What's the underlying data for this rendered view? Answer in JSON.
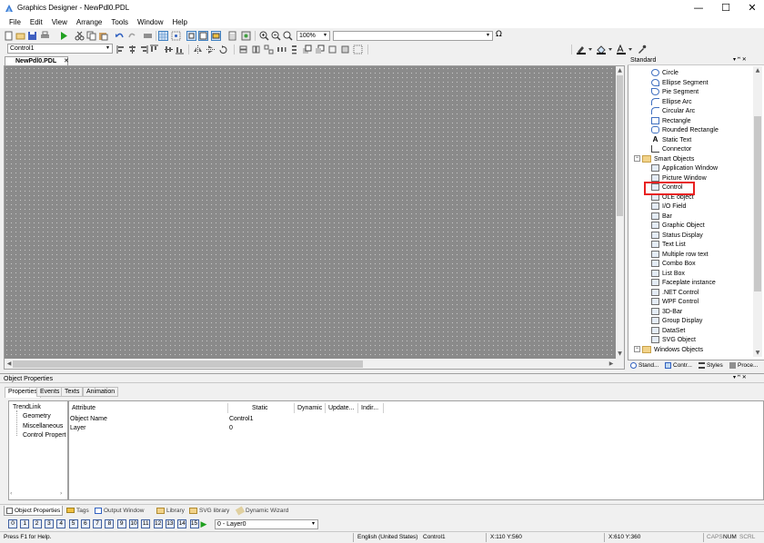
{
  "window": {
    "title": "Graphics Designer - NewPdl0.PDL",
    "minimize": "—",
    "maximize": "☐",
    "close": "✕"
  },
  "menu": [
    "File",
    "Edit",
    "View",
    "Arrange",
    "Tools",
    "Window",
    "Help"
  ],
  "toolbar": {
    "zoom_value": "100%",
    "font_field": "",
    "object_select": "Control1"
  },
  "palette": [
    "#c00000",
    "#ff0000",
    "#ff8000",
    "#ffff00",
    "#c0c000",
    "#00a000",
    "#00ff00",
    "#008080",
    "#00ffff",
    "#0000c0",
    "#0000ff",
    "#800080",
    "#ff00ff",
    "#808080",
    "#c0c0c0",
    "#ffffff",
    "#000000"
  ],
  "document_tab": {
    "label": "NewPdl0.PDL",
    "close": "✕"
  },
  "right_panel": {
    "title": "Standard",
    "header_btns": "▾ ꟸ ✕",
    "items": [
      {
        "label": "Circle",
        "icon": "circle-icon",
        "kind": "item"
      },
      {
        "label": "Ellipse Segment",
        "icon": "ellipse-segment-icon",
        "kind": "item"
      },
      {
        "label": "Pie Segment",
        "icon": "pie-segment-icon",
        "kind": "item"
      },
      {
        "label": "Ellipse Arc",
        "icon": "ellipse-arc-icon",
        "kind": "item"
      },
      {
        "label": "Circular Arc",
        "icon": "circular-arc-icon",
        "kind": "item"
      },
      {
        "label": "Rectangle",
        "icon": "rectangle-icon",
        "kind": "item"
      },
      {
        "label": "Rounded Rectangle",
        "icon": "rounded-rectangle-icon",
        "kind": "item"
      },
      {
        "label": "Static Text",
        "icon": "static-text-icon",
        "kind": "item"
      },
      {
        "label": "Connector",
        "icon": "connector-icon",
        "kind": "item"
      },
      {
        "label": "Smart Objects",
        "icon": "folder-icon",
        "kind": "folder"
      },
      {
        "label": "Application Window",
        "icon": "application-window-icon",
        "kind": "item"
      },
      {
        "label": "Picture Window",
        "icon": "picture-window-icon",
        "kind": "item"
      },
      {
        "label": "Control",
        "icon": "control-icon",
        "kind": "item"
      },
      {
        "label": "OLE object",
        "icon": "ole-object-icon",
        "kind": "item"
      },
      {
        "label": "I/O Field",
        "icon": "io-field-icon",
        "kind": "item"
      },
      {
        "label": "Bar",
        "icon": "bar-icon",
        "kind": "item"
      },
      {
        "label": "Graphic Object",
        "icon": "graphic-object-icon",
        "kind": "item"
      },
      {
        "label": "Status Display",
        "icon": "status-display-icon",
        "kind": "item"
      },
      {
        "label": "Text List",
        "icon": "text-list-icon",
        "kind": "item"
      },
      {
        "label": "Multiple row text",
        "icon": "multiple-row-text-icon",
        "kind": "item"
      },
      {
        "label": "Combo Box",
        "icon": "combo-box-icon",
        "kind": "item"
      },
      {
        "label": "List Box",
        "icon": "list-box-icon",
        "kind": "item"
      },
      {
        "label": "Faceplate instance",
        "icon": "faceplate-icon",
        "kind": "item"
      },
      {
        "label": ".NET Control",
        "icon": "dotnet-control-icon",
        "kind": "item"
      },
      {
        "label": "WPF Control",
        "icon": "wpf-control-icon",
        "kind": "item"
      },
      {
        "label": "3D-Bar",
        "icon": "3d-bar-icon",
        "kind": "item"
      },
      {
        "label": "Group Display",
        "icon": "group-display-icon",
        "kind": "item"
      },
      {
        "label": "DataSet",
        "icon": "dataset-icon",
        "kind": "item"
      },
      {
        "label": "SVG Object",
        "icon": "svg-object-icon",
        "kind": "item"
      },
      {
        "label": "Windows Objects",
        "icon": "folder-icon",
        "kind": "folder"
      }
    ],
    "highlighted_item": "Control",
    "tabs": [
      "Stand...",
      "Contr...",
      "Styles",
      "Proce..."
    ]
  },
  "object_properties": {
    "title": "Object Properties",
    "header_btns": "▾ ꟸ ✕",
    "tabs": [
      "Properties",
      "Events",
      "Texts",
      "Animation"
    ],
    "tree": [
      "TrendLink",
      "Geometry",
      "Miscellaneous",
      "Control Propert"
    ],
    "columns": [
      "Attribute",
      "Static",
      "Dynamic",
      "Update...",
      "Indir..."
    ],
    "rows": [
      {
        "attribute": "Object Name",
        "static": "Control1"
      },
      {
        "attribute": "Layer",
        "static": "0"
      }
    ]
  },
  "bottom_tabs": [
    "Object Properties",
    "Tags",
    "Output Window",
    "Library",
    "SVG library",
    "Dynamic Wizard"
  ],
  "layers": {
    "buttons": [
      "0",
      "1",
      "2",
      "3",
      "4",
      "5",
      "6",
      "7",
      "8",
      "9",
      "10",
      "11",
      "12",
      "13",
      "14",
      "15"
    ],
    "selected": "0 - Layer0"
  },
  "status": {
    "help": "Press F1 for Help.",
    "language": "English (United States)",
    "object": "Control1",
    "pos": "X:110 Y:560",
    "size": "X:610 Y:360",
    "caps": "CAPS",
    "num": "NUM",
    "scrl": "SCRL"
  }
}
